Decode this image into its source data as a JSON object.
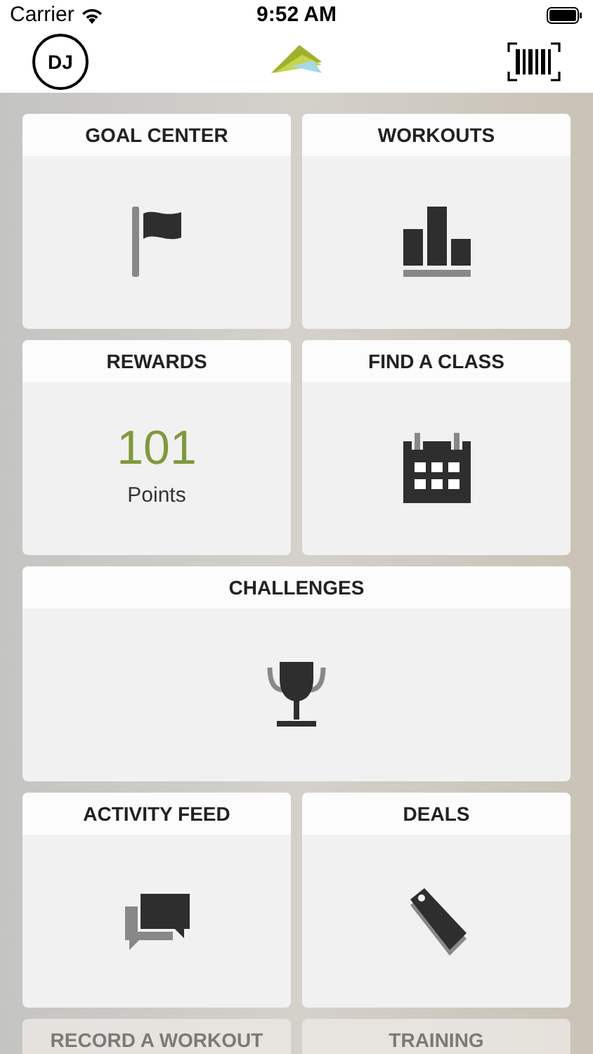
{
  "status_bar": {
    "carrier": "Carrier",
    "time": "9:52 AM"
  },
  "nav": {
    "avatar_initials": "DJ"
  },
  "tiles": [
    {
      "title": "GOAL CENTER",
      "kind": "flag"
    },
    {
      "title": "WORKOUTS",
      "kind": "bars"
    },
    {
      "title": "REWARDS",
      "kind": "points",
      "value": "101",
      "unit": "Points"
    },
    {
      "title": "FIND A CLASS",
      "kind": "calendar"
    },
    {
      "title": "CHALLENGES",
      "kind": "trophy",
      "wide": true
    },
    {
      "title": "ACTIVITY FEED",
      "kind": "chat"
    },
    {
      "title": "DEALS",
      "kind": "tag"
    },
    {
      "title": "RECORD A WORKOUT",
      "kind": "cut"
    },
    {
      "title": "TRAINING",
      "kind": "cut"
    }
  ]
}
